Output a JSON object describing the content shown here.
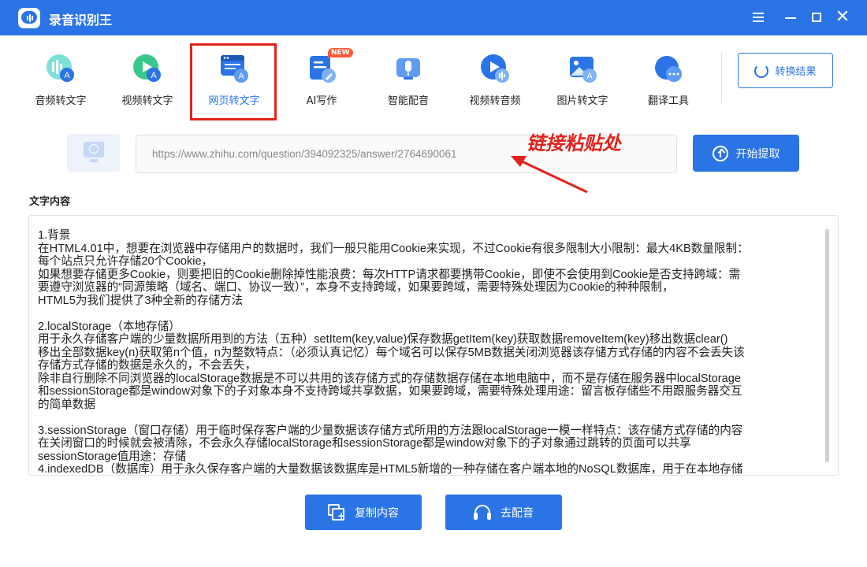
{
  "app": {
    "title": "录音识别王"
  },
  "toolbar": {
    "tools": [
      {
        "label": "音频转文字",
        "icon": "audio-to-text-icon"
      },
      {
        "label": "视频转文字",
        "icon": "video-to-text-icon"
      },
      {
        "label": "网页转文字",
        "icon": "webpage-to-text-icon",
        "active": true
      },
      {
        "label": "AI写作",
        "icon": "ai-writing-icon",
        "badge": "NEW"
      },
      {
        "label": "智能配音",
        "icon": "smart-dubbing-icon"
      },
      {
        "label": "视频转音频",
        "icon": "video-to-audio-icon"
      },
      {
        "label": "图片转文字",
        "icon": "image-to-text-icon"
      },
      {
        "label": "翻译工具",
        "icon": "translate-icon"
      }
    ],
    "convert_result_label": "转换结果"
  },
  "url_row": {
    "url_value": "https://www.zhihu.com/question/394092325/answer/2764690061",
    "extract_label": "开始提取",
    "annotation": "链接粘贴处"
  },
  "content": {
    "label": "文字内容",
    "text": "1.背景\n在HTML4.01中，想要在浏览器中存储用户的数据时，我们一般只能用Cookie来实现，不过Cookie有很多限制大小限制：最大4KB数量限制：\n每个站点只允许存储20个Cookie，\n如果想要存储更多Cookie，则要把旧的Cookie删除掉性能浪费：每次HTTP请求都要携带Cookie，即使不会使用到Cookie是否支持跨域：需\n要遵守浏览器的“同源策略（域名、端口、协议一致）”，本身不支持跨域，如果要跨域，需要特殊处理因为Cookie的种种限制，\nHTML5为我们提供了3种全新的存储方法\n\n2.localStorage（本地存储）\n用于永久存储客户端的少量数据所用到的方法（五种）setItem(key,value)保存数据getItem(key)获取数据removeItem(key)移出数据clear()\n移出全部数据key(n)获取第n个值，n为整数特点：（必须认真记忆）每个域名可以保存5MB数据关闭浏览器该存储方式存储的内容不会丢失该\n存储方式存储的数据是永久的，不会丢失，\n除非自行删除不同浏览器的localStorage数据是不可以共用的该存储方式的存储数据存储在本地电脑中，而不是存储在服务器中localStorage\n和sessionStorage都是window对象下的子对象本身不支持跨域共享数据，如果要跨域，需要特殊处理用途：留言板存储些不用跟服务器交互\n的简单数据\n\n3.sessionStorage（窗口存储）用于临时保存客户端的少量数据该存储方式所用的方法跟localStorage一模一样特点：该存储方式存储的内容\n在关闭窗口的时候就会被清除，不会永久存储localStorage和sessionStorage都是window对象下的子对象通过跳转的页面可以共享\nsessionStorage值用途：存储\n4.indexedDB（数据库）用于永久保存客户端的大量数据该数据库是HTML5新增的一种存储在客户端本地的NoSQL数据库，用于在本地存储"
  },
  "actions": {
    "copy_label": "复制内容",
    "dub_label": "去配音"
  },
  "colors": {
    "accent": "#2a74e6",
    "highlight": "#e0231c"
  }
}
